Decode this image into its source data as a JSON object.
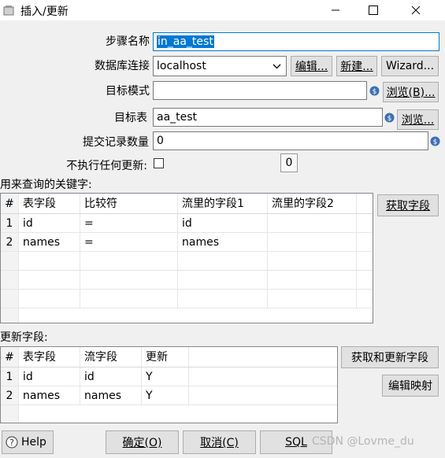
{
  "window": {
    "title": "插入/更新",
    "icon": "kettle-app-icon"
  },
  "form": {
    "step_name_label": "步骤名称",
    "step_name_value": "in_aa_test",
    "db_label": "数据库连接",
    "db_value": "localhost",
    "edit_btn": "编辑...",
    "new_btn": "新建...",
    "wizard_btn": "Wizard...",
    "schema_label": "目标模式",
    "schema_value": "",
    "browse_b_btn": "浏览(B)...",
    "table_label": "目标表",
    "table_value": "aa_test",
    "browse_btn": "浏览...",
    "commit_label": "提交记录数量",
    "commit_value": "0",
    "no_update_label": "不执行任何更新:",
    "no_update_checked": false,
    "tooltip_value": "0"
  },
  "keys": {
    "section_label": "用来查询的关键字:",
    "get_fields_btn": "获取字段",
    "columns": [
      "#",
      "表字段",
      "比较符",
      "流里的字段1",
      "流里的字段2"
    ],
    "rows": [
      [
        "1",
        "id",
        "=",
        "id",
        ""
      ],
      [
        "2",
        "names",
        "=",
        "names",
        ""
      ]
    ]
  },
  "update": {
    "section_label": "更新字段:",
    "get_update_btn": "获取和更新字段",
    "edit_mapping_btn": "编辑映射",
    "columns": [
      "#",
      "表字段",
      "流字段",
      "更新"
    ],
    "rows": [
      [
        "1",
        "id",
        "id",
        "Y"
      ],
      [
        "2",
        "names",
        "names",
        "Y"
      ]
    ]
  },
  "footer": {
    "help": "Help",
    "ok": "确定(O)",
    "cancel": "取消(C)",
    "sql": "SQL",
    "watermark": "CSDN @Lovme_du"
  }
}
